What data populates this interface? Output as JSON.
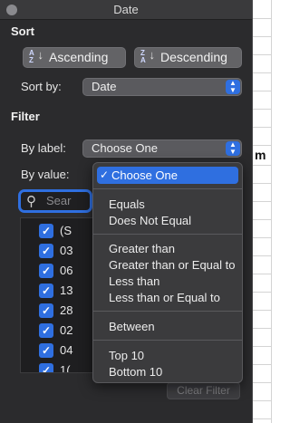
{
  "window": {
    "title": "Date"
  },
  "sort": {
    "heading": "Sort",
    "ascending_label": "Ascending",
    "descending_label": "Descending",
    "sort_by_label": "Sort by:",
    "sort_by_value": "Date"
  },
  "filter": {
    "heading": "Filter",
    "by_label_label": "By label:",
    "by_label_value": "Choose One",
    "by_value_label": "By value:",
    "search_placeholder": "Sear",
    "items": [
      "(S",
      "03",
      "06",
      "13",
      "28",
      "02",
      "04",
      "1("
    ],
    "clear_label": "Clear Filter"
  },
  "menu": {
    "selected": "Choose One",
    "group1": [
      "Equals",
      "Does Not Equal"
    ],
    "group2": [
      "Greater than",
      "Greater than or Equal to",
      "Less than",
      "Less than or Equal to"
    ],
    "group3": [
      "Between"
    ],
    "group4": [
      "Top 10",
      "Bottom 10"
    ]
  },
  "sheet": {
    "cell_text": "m"
  },
  "colors": {
    "accent": "#2f6fe0",
    "panel": "#2b2b2d",
    "menu": "#3b3b3d"
  }
}
